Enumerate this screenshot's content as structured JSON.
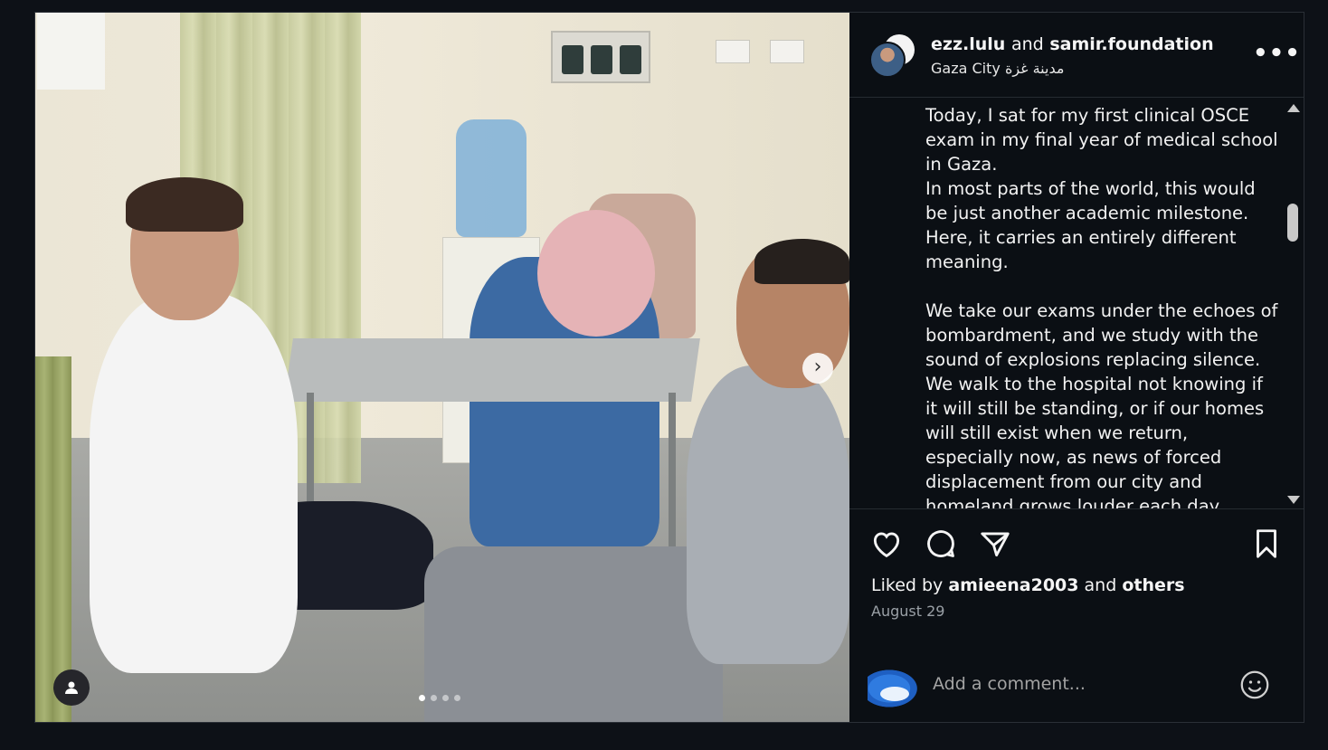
{
  "post": {
    "owner": "ezz.lulu",
    "and_word": "and",
    "collaborator": "samir.foundation",
    "location": "Gaza City مدينة غزة",
    "more_label": "•••",
    "caption": [
      "Today, I sat for my first clinical OSCE exam in my final year of medical school in Gaza.",
      "In most parts of the world, this would be just another academic milestone. Here, it carries an entirely different meaning.",
      "",
      "We take our exams under the echoes of bombardment, and we study with the sound of explosions replacing silence. We walk to the hospital not knowing if it will still be standing, or if our homes will still exist when we return, especially now, as news of forced displacement from our city and homeland grows louder each day."
    ],
    "liked_prefix": "Liked by",
    "liked_user": "amieena2003",
    "liked_and": "and",
    "liked_others": "others",
    "date": "August 29",
    "comment_placeholder": "Add a comment...",
    "carousel": {
      "total": 4,
      "current": 1
    }
  },
  "icons": {
    "like": "heart-icon",
    "comment": "comment-bubble-icon",
    "share": "paper-plane-icon",
    "save": "bookmark-icon",
    "emoji": "smiley-icon",
    "next": "chevron-right-icon",
    "tags": "user-icon"
  },
  "colors": {
    "background": "#0d1117",
    "panel": "#0b0f14",
    "text": "#f5f5f5",
    "muted": "#9aa0a6"
  }
}
